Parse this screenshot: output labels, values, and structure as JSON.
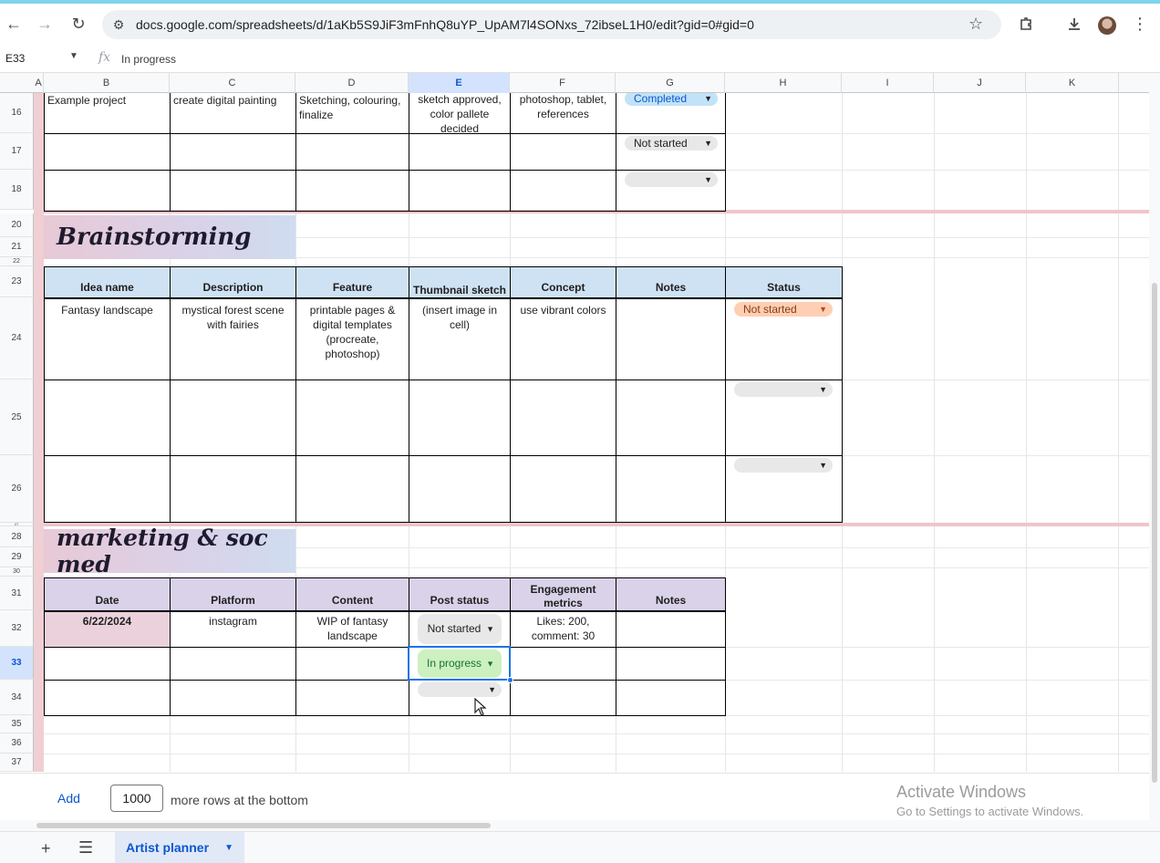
{
  "browser": {
    "url": "docs.google.com/spreadsheets/d/1aKb5S9JiF3mFnhQ8uYP_UpAM7l4SONxs_72ibseL1H0/edit?gid=0#gid=0",
    "icons": [
      "back-icon",
      "forward-icon",
      "reload-icon",
      "tune-icon",
      "star-icon",
      "extensions-icon",
      "download-icon",
      "avatar",
      "more-icon"
    ]
  },
  "formula_bar": {
    "name_box": "E33",
    "fx": "fx",
    "value": "In progress"
  },
  "columns": [
    "A",
    "B",
    "C",
    "D",
    "E",
    "F",
    "G",
    "H",
    "I",
    "J",
    "K"
  ],
  "rows": [
    "16",
    "17",
    "18",
    "20",
    "21",
    "22",
    "23",
    "24",
    "25",
    "26",
    "27",
    "28",
    "29",
    "30",
    "31",
    "32",
    "33",
    "34",
    "35",
    "36",
    "37"
  ],
  "project_table": {
    "row16": {
      "name": "Example project",
      "task": "create digital painting",
      "steps": "Sketching, colouring, finalize",
      "milestones": "sketch approved, color pallete decided",
      "tools": "photoshop, tablet, references",
      "status": "Completed"
    },
    "row17_status": "Not started"
  },
  "brainstorming": {
    "title": "Brainstorming",
    "headers": [
      "Idea name",
      "Description",
      "Feature",
      "Thumbnail sketch",
      "Concept",
      "Notes",
      "Status"
    ],
    "row24": {
      "idea": "Fantasy landscape",
      "description": "mystical forest scene with fairies",
      "feature": "printable pages & digital templates (procreate, photoshop)",
      "thumbnail": "(insert image in cell)",
      "concept": "use vibrant colors",
      "notes": "",
      "status": "Not started"
    }
  },
  "marketing": {
    "title": "marketing & soc med",
    "headers": [
      "Date",
      "Platform",
      "Content",
      "Post status",
      "Engagement metrics",
      "Notes"
    ],
    "row32": {
      "date": "6/22/2024",
      "platform": "instagram",
      "content": "WIP of fantasy landscape",
      "status": "Not started",
      "metrics": "Likes: 200, comment: 30",
      "notes": ""
    },
    "row33_status": "In progress"
  },
  "colors": {
    "completed": "#c2e3f7",
    "not_started": "#e8e8e8",
    "not_started_orange": "#ffcfb3",
    "in_progress": "#cdf0c0",
    "header_blue": "#cfe2f3",
    "header_purple": "#d9d2e9",
    "pink": "#efc5cb"
  },
  "bottom": {
    "add_label": "Add",
    "rows_value": "1000",
    "rows_suffix": "more rows at the bottom"
  },
  "activate": {
    "title": "Activate Windows",
    "subtitle": "Go to Settings to activate Windows."
  },
  "sheets": {
    "active": "Artist planner"
  }
}
